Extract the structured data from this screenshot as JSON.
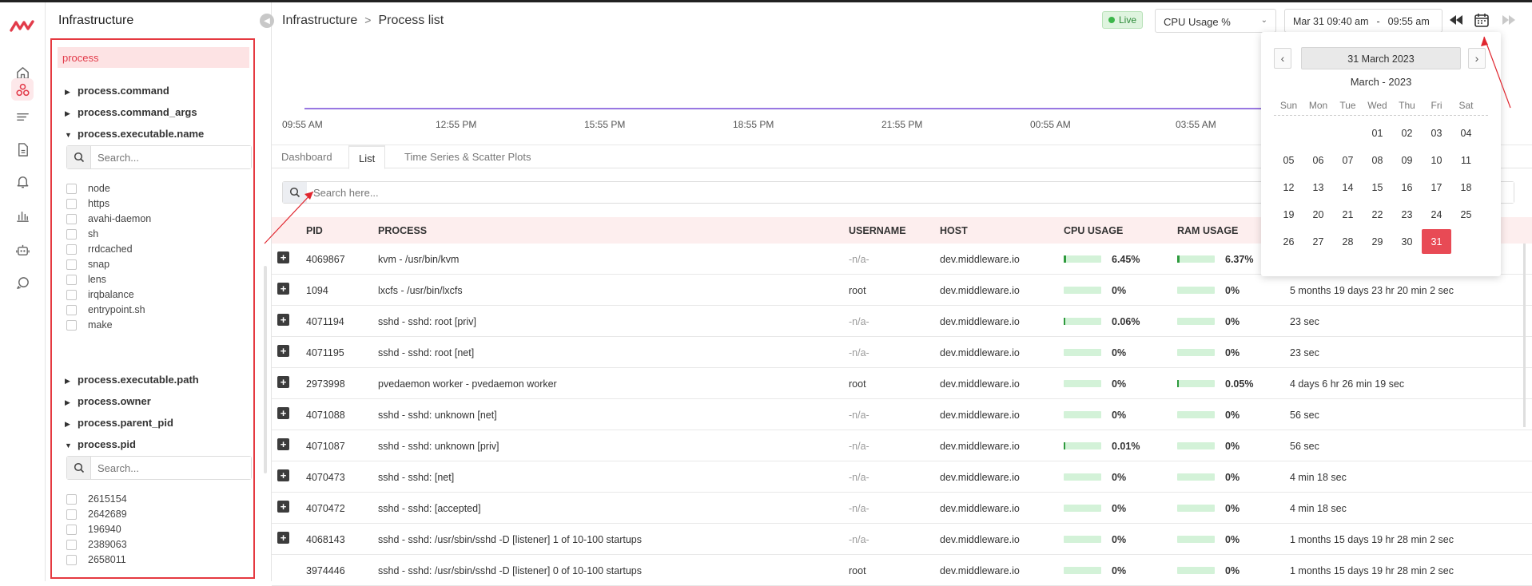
{
  "rail": {
    "items": [
      "home-icon",
      "infrastructure-icon",
      "logs-icon",
      "reports-icon",
      "alerts-icon",
      "dashboards-icon",
      "bot-icon",
      "help-icon"
    ],
    "accent": "#e23b4a"
  },
  "panel": {
    "title": "Infrastructure",
    "search_value": "process",
    "groups": {
      "command": "process.command",
      "command_args": "process.command_args",
      "executable_name": "process.executable.name",
      "executable_path": "process.executable.path",
      "owner": "process.owner",
      "parent_pid": "process.parent_pid",
      "pid": "process.pid"
    },
    "executable_search_placeholder": "Search...",
    "executable_items": [
      "node",
      "https",
      "avahi-daemon",
      "sh",
      "rrdcached",
      "snap",
      "lens",
      "irqbalance",
      "entrypoint.sh",
      "make"
    ],
    "pid_search_placeholder": "Search...",
    "pid_items": [
      "2615154",
      "2642689",
      "196940",
      "2389063",
      "2658011"
    ]
  },
  "header": {
    "crumb_root": "Infrastructure",
    "crumb_sep": ">",
    "crumb_page": "Process list",
    "live": "Live",
    "metric": "CPU Usage %",
    "range_from": "Mar 31 09:40 am",
    "range_sep": "-",
    "range_to": "09:55 am"
  },
  "chart": {
    "ticks": [
      "09:55 AM",
      "12:55 PM",
      "15:55 PM",
      "18:55 PM",
      "21:55 PM",
      "00:55 AM",
      "03:55 AM"
    ]
  },
  "tabs": [
    "Dashboard",
    "List",
    "Time Series & Scatter Plots"
  ],
  "table": {
    "search_placeholder": "Search here...",
    "headers": {
      "pid": "PID",
      "process": "PROCESS",
      "username": "USERNAME",
      "host": "HOST",
      "cpu": "CPU USAGE",
      "ram": "RAM USAGE"
    },
    "rows": [
      {
        "pid": "4069867",
        "process": "kvm - /usr/bin/kvm",
        "user": "-n/a-",
        "host": "dev.middleware.io",
        "cpu": "6.45%",
        "cpu_frac": 0.06,
        "ram": "6.37%",
        "ram_frac": 0.06,
        "uptime": ""
      },
      {
        "pid": "1094",
        "process": "lxcfs - /usr/bin/lxcfs",
        "user": "root",
        "host": "dev.middleware.io",
        "cpu": "0%",
        "cpu_frac": 0,
        "ram": "0%",
        "ram_frac": 0,
        "uptime": "5 months 19 days 23 hr 20 min 2 sec"
      },
      {
        "pid": "4071194",
        "process": "sshd - sshd: root [priv]",
        "user": "-n/a-",
        "host": "dev.middleware.io",
        "cpu": "0.06%",
        "cpu_frac": 0.05,
        "ram": "0%",
        "ram_frac": 0,
        "uptime": "23 sec"
      },
      {
        "pid": "4071195",
        "process": "sshd - sshd: root [net]",
        "user": "-n/a-",
        "host": "dev.middleware.io",
        "cpu": "0%",
        "cpu_frac": 0,
        "ram": "0%",
        "ram_frac": 0,
        "uptime": "23 sec"
      },
      {
        "pid": "2973998",
        "process": "pvedaemon worker - pvedaemon worker",
        "user": "root",
        "host": "dev.middleware.io",
        "cpu": "0%",
        "cpu_frac": 0,
        "ram": "0.05%",
        "ram_frac": 0.05,
        "uptime": "4 days 6 hr 26 min 19 sec"
      },
      {
        "pid": "4071088",
        "process": "sshd - sshd: unknown [net]",
        "user": "-n/a-",
        "host": "dev.middleware.io",
        "cpu": "0%",
        "cpu_frac": 0,
        "ram": "0%",
        "ram_frac": 0,
        "uptime": "56 sec"
      },
      {
        "pid": "4071087",
        "process": "sshd - sshd: unknown [priv]",
        "user": "-n/a-",
        "host": "dev.middleware.io",
        "cpu": "0.01%",
        "cpu_frac": 0.05,
        "ram": "0%",
        "ram_frac": 0,
        "uptime": "56 sec"
      },
      {
        "pid": "4070473",
        "process": "sshd - sshd: [net]",
        "user": "-n/a-",
        "host": "dev.middleware.io",
        "cpu": "0%",
        "cpu_frac": 0,
        "ram": "0%",
        "ram_frac": 0,
        "uptime": "4 min 18 sec"
      },
      {
        "pid": "4070472",
        "process": "sshd - sshd: [accepted]",
        "user": "-n/a-",
        "host": "dev.middleware.io",
        "cpu": "0%",
        "cpu_frac": 0,
        "ram": "0%",
        "ram_frac": 0,
        "uptime": "4 min 18 sec"
      },
      {
        "pid": "4068143",
        "process": "sshd - sshd: /usr/sbin/sshd -D [listener] 1 of 10-100 startups",
        "user": "-n/a-",
        "host": "dev.middleware.io",
        "cpu": "0%",
        "cpu_frac": 0,
        "ram": "0%",
        "ram_frac": 0,
        "uptime": "1 months 15 days 19 hr 28 min 2 sec"
      },
      {
        "pid": "3974446",
        "process": "sshd - sshd: /usr/sbin/sshd -D [listener] 0 of 10-100 startups",
        "user": "root",
        "host": "dev.middleware.io",
        "cpu": "0%",
        "cpu_frac": 0,
        "ram": "0%",
        "ram_frac": 0,
        "uptime": "1 months 15 days 19 hr 28 min 2 sec"
      }
    ]
  },
  "calendar": {
    "prev": "‹",
    "next": "›",
    "selected_label": "31 March 2023",
    "month_title": "March - 2023",
    "weekdays": [
      "Sun",
      "Mon",
      "Tue",
      "Wed",
      "Thu",
      "Fri",
      "Sat"
    ],
    "first_weekday": 3,
    "days": [
      "01",
      "02",
      "03",
      "04",
      "05",
      "06",
      "07",
      "08",
      "09",
      "10",
      "11",
      "12",
      "13",
      "14",
      "15",
      "16",
      "17",
      "18",
      "19",
      "20",
      "21",
      "22",
      "23",
      "24",
      "25",
      "26",
      "27",
      "28",
      "29",
      "30",
      "31"
    ],
    "selected_day": "31",
    "selected_color": "#e84a55"
  }
}
